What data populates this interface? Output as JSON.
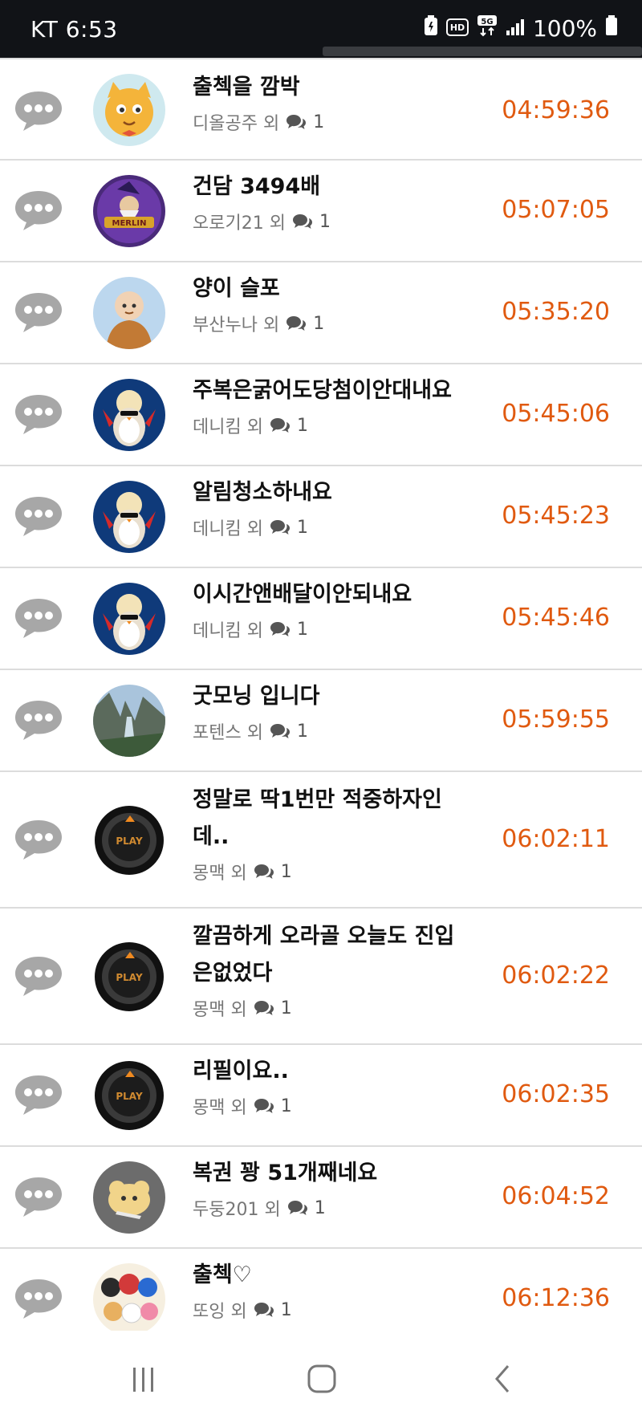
{
  "status_bar": {
    "carrier_time": "KT 6:53",
    "battery": "100%",
    "icons": [
      "battery-saver-icon",
      "hd-icon",
      "5g-icon",
      "signal-icon",
      "battery-icon"
    ]
  },
  "rows": [
    {
      "title": "출첵을 깜박",
      "author": "디올공주 외",
      "count": "1",
      "time": "04:59:36",
      "avatar": "cat-avatar"
    },
    {
      "title": "건담 3494배",
      "author": "오로기21 외",
      "count": "1",
      "time": "05:07:05",
      "avatar": "wizard-avatar"
    },
    {
      "title": "양이 슬포",
      "author": "부산누나 외",
      "count": "1",
      "time": "05:35:20",
      "avatar": "monk-avatar"
    },
    {
      "title": "주복은굵어도당첨이안대내요",
      "author": "데니킴 외",
      "count": "1",
      "time": "05:45:06",
      "avatar": "penguin-avatar"
    },
    {
      "title": "알림청소하내요",
      "author": "데니킴 외",
      "count": "1",
      "time": "05:45:23",
      "avatar": "penguin-avatar"
    },
    {
      "title": "이시간앤배달이안되내요",
      "author": "데니킴 외",
      "count": "1",
      "time": "05:45:46",
      "avatar": "penguin-avatar"
    },
    {
      "title": "굿모닝 입니다",
      "author": "포텐스 외",
      "count": "1",
      "time": "05:59:55",
      "avatar": "mountain-avatar"
    },
    {
      "title": "정말로 딱1번만 적중하자인데..",
      "author": "몽맥 외",
      "count": "1",
      "time": "06:02:11",
      "avatar": "play-avatar"
    },
    {
      "title": "깔끔하게 오라골 오늘도 진입은없었다",
      "author": "몽맥 외",
      "count": "1",
      "time": "06:02:22",
      "avatar": "play-avatar"
    },
    {
      "title": "리필이요..",
      "author": "몽맥 외",
      "count": "1",
      "time": "06:02:35",
      "avatar": "play-avatar"
    },
    {
      "title": "복권 꽝 51개째네요",
      "author": "두둥201 외",
      "count": "1",
      "time": "06:04:52",
      "avatar": "plush-avatar"
    },
    {
      "title": "출첵♡",
      "author": "또잉 외",
      "count": "1",
      "time": "06:12:36",
      "avatar": "group-avatar"
    }
  ],
  "colors": {
    "time": "#e05a10",
    "title": "#111111",
    "meta": "#777777",
    "divider": "#dcdcdc"
  },
  "nav": [
    "recent-apps-icon",
    "home-icon",
    "back-icon"
  ]
}
